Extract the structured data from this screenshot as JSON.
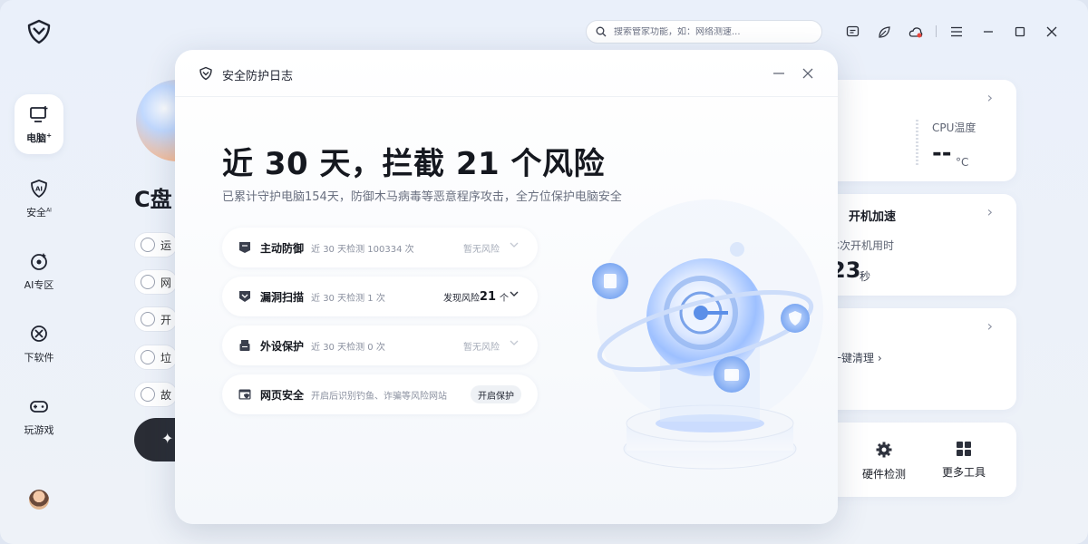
{
  "sidebar": {
    "items": [
      {
        "label": "电脑",
        "sup": "+",
        "icon": "computer-icon"
      },
      {
        "label": "安全",
        "sup": "AI",
        "icon": "ai-shield-icon"
      },
      {
        "label": "AI专区",
        "sup": "",
        "icon": "ai-zone-icon"
      },
      {
        "label": "下软件",
        "sup": "",
        "icon": "software-download-icon"
      },
      {
        "label": "玩游戏",
        "sup": "",
        "icon": "gamepad-icon"
      }
    ]
  },
  "topbar": {
    "search_placeholder": "搜索管家功能，如：网络测速..."
  },
  "background": {
    "title": "C盘",
    "rows": [
      "运",
      "网",
      "开",
      "垃",
      "故"
    ],
    "cpu_label": "CPU温度",
    "cpu_value": "--",
    "cpu_unit": "°C",
    "boot_title": "开机加速",
    "boot_sub": "本次开机用时",
    "boot_value": "23",
    "boot_unit": "秒",
    "clean_link": "一键清理",
    "tools": [
      {
        "label": "硬件检测",
        "icon": "gear-icon"
      },
      {
        "label": "更多工具",
        "icon": "grid-icon"
      }
    ]
  },
  "dialog": {
    "title": "安全防护日志",
    "headline": "近 30 天，拦截 21 个风险",
    "subline": "已累计守护电脑154天，防御木马病毒等恶意程序攻击，全方位保护电脑安全",
    "rows": [
      {
        "name": "主动防御",
        "desc": "近 30 天检测 100334 次",
        "status": "暂无风险"
      },
      {
        "name": "漏洞扫描",
        "desc": "近 30 天检测 1 次",
        "risk_label": "发现风险",
        "risk_count": "21",
        "risk_unit": "个"
      },
      {
        "name": "外设保护",
        "desc": "近 30 天检测 0 次",
        "status": "暂无风险"
      },
      {
        "name": "网页安全",
        "desc": "开启后识别钓鱼、诈骗等风险网站",
        "action": "开启保护"
      }
    ]
  },
  "colors": {
    "accent_blue": "#3e7bf0",
    "dark_text": "#15181f",
    "muted_text": "#8a909f"
  }
}
